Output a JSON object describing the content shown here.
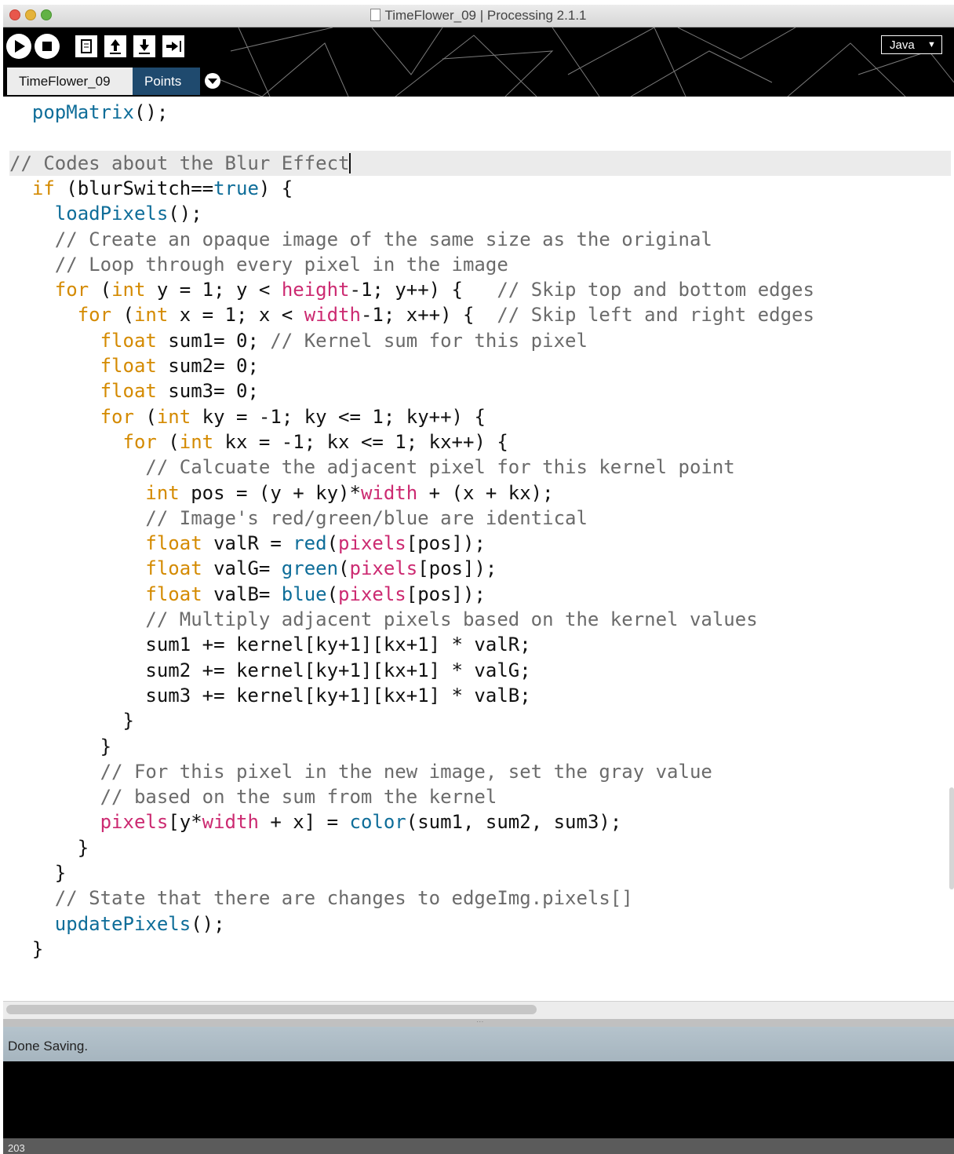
{
  "window": {
    "title": "TimeFlower_09 | Processing 2.1.1"
  },
  "toolbar": {
    "mode_label": "Java",
    "buttons": [
      "run-icon",
      "stop-icon",
      "new-icon",
      "open-icon",
      "save-icon",
      "export-icon"
    ]
  },
  "tabs": [
    {
      "label": "TimeFlower_09",
      "active": true
    },
    {
      "label": "Points",
      "active": false
    }
  ],
  "colors": {
    "keyword": "#d48a00",
    "function": "#0e6d99",
    "variable": "#cc2a71",
    "comment": "#6b6b6b",
    "status_bar": "#b5c3cc",
    "tab_inactive": "#1f4a6e"
  },
  "code": {
    "highlighted_line": 2,
    "lines": [
      [
        [
          "fn",
          "  popMatrix"
        ],
        [
          "tx",
          "();"
        ]
      ],
      [],
      [
        [
          "cm",
          "// Codes about the Blur Effect"
        ]
      ],
      [
        [
          "kw",
          "  if"
        ],
        [
          "tx",
          " (blurSwitch=="
        ],
        [
          "lit",
          "true"
        ],
        [
          "tx",
          ") {"
        ]
      ],
      [
        [
          "fn",
          "    loadPixels"
        ],
        [
          "tx",
          "();"
        ]
      ],
      [
        [
          "cm",
          "    // Create an opaque image of the same size as the original"
        ]
      ],
      [
        [
          "cm",
          "    // Loop through every pixel in the image"
        ]
      ],
      [
        [
          "kw",
          "    for"
        ],
        [
          "tx",
          " ("
        ],
        [
          "kw",
          "int"
        ],
        [
          "tx",
          " y = 1; y < "
        ],
        [
          "var",
          "height"
        ],
        [
          "tx",
          "-1; y++) {   "
        ],
        [
          "cm",
          "// Skip top and bottom edges"
        ]
      ],
      [
        [
          "kw",
          "      for"
        ],
        [
          "tx",
          " ("
        ],
        [
          "kw",
          "int"
        ],
        [
          "tx",
          " x = 1; x < "
        ],
        [
          "var",
          "width"
        ],
        [
          "tx",
          "-1; x++) {  "
        ],
        [
          "cm",
          "// Skip left and right edges"
        ]
      ],
      [
        [
          "kw",
          "        float"
        ],
        [
          "tx",
          " sum1= 0; "
        ],
        [
          "cm",
          "// Kernel sum for this pixel"
        ]
      ],
      [
        [
          "kw",
          "        float"
        ],
        [
          "tx",
          " sum2= 0;"
        ]
      ],
      [
        [
          "kw",
          "        float"
        ],
        [
          "tx",
          " sum3= 0;"
        ]
      ],
      [
        [
          "kw",
          "        for"
        ],
        [
          "tx",
          " ("
        ],
        [
          "kw",
          "int"
        ],
        [
          "tx",
          " ky = -1; ky <= 1; ky++) {"
        ]
      ],
      [
        [
          "kw",
          "          for"
        ],
        [
          "tx",
          " ("
        ],
        [
          "kw",
          "int"
        ],
        [
          "tx",
          " kx = -1; kx <= 1; kx++) {"
        ]
      ],
      [
        [
          "cm",
          "            // Calcuate the adjacent pixel for this kernel point"
        ]
      ],
      [
        [
          "kw",
          "            int"
        ],
        [
          "tx",
          " pos = (y + ky)*"
        ],
        [
          "var",
          "width"
        ],
        [
          "tx",
          " + (x + kx);"
        ]
      ],
      [
        [
          "cm",
          "            // Image's red/green/blue are identical"
        ]
      ],
      [
        [
          "kw",
          "            float"
        ],
        [
          "tx",
          " valR = "
        ],
        [
          "fn",
          "red"
        ],
        [
          "tx",
          "("
        ],
        [
          "var",
          "pixels"
        ],
        [
          "tx",
          "[pos]);"
        ]
      ],
      [
        [
          "kw",
          "            float"
        ],
        [
          "tx",
          " valG= "
        ],
        [
          "fn",
          "green"
        ],
        [
          "tx",
          "("
        ],
        [
          "var",
          "pixels"
        ],
        [
          "tx",
          "[pos]);"
        ]
      ],
      [
        [
          "kw",
          "            float"
        ],
        [
          "tx",
          " valB= "
        ],
        [
          "fn",
          "blue"
        ],
        [
          "tx",
          "("
        ],
        [
          "var",
          "pixels"
        ],
        [
          "tx",
          "[pos]);"
        ]
      ],
      [
        [
          "cm",
          "            // Multiply adjacent pixels based on the kernel values"
        ]
      ],
      [
        [
          "tx",
          "            sum1 += kernel[ky+1][kx+1] * valR;"
        ]
      ],
      [
        [
          "tx",
          "            sum2 += kernel[ky+1][kx+1] * valG;"
        ]
      ],
      [
        [
          "tx",
          "            sum3 += kernel[ky+1][kx+1] * valB;"
        ]
      ],
      [
        [
          "tx",
          "          }"
        ]
      ],
      [
        [
          "tx",
          "        }"
        ]
      ],
      [
        [
          "cm",
          "        // For this pixel in the new image, set the gray value"
        ]
      ],
      [
        [
          "cm",
          "        // based on the sum from the kernel"
        ]
      ],
      [
        [
          "var",
          "        pixels"
        ],
        [
          "tx",
          "[y*"
        ],
        [
          "var",
          "width"
        ],
        [
          "tx",
          " + x] = "
        ],
        [
          "fn",
          "color"
        ],
        [
          "tx",
          "(sum1, sum2, sum3);"
        ]
      ],
      [
        [
          "tx",
          "      }"
        ]
      ],
      [
        [
          "tx",
          "    }"
        ]
      ],
      [
        [
          "cm",
          "    // State that there are changes to edgeImg.pixels[]"
        ]
      ],
      [
        [
          "fn",
          "    updatePixels"
        ],
        [
          "tx",
          "();"
        ]
      ],
      [
        [
          "tx",
          "  }"
        ]
      ]
    ]
  },
  "status": {
    "message": "Done Saving."
  },
  "footer": {
    "line_number": "203"
  }
}
